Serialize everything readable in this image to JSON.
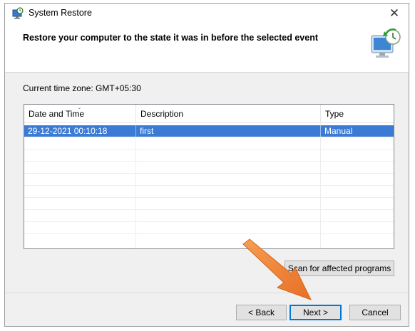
{
  "window": {
    "title": "System Restore",
    "close_glyph": "✕"
  },
  "header": {
    "heading": "Restore your computer to the state it was in before the selected event",
    "icon": "system-restore-monitor-icon"
  },
  "timezone_label": "Current time zone: GMT+05:30",
  "table": {
    "columns": [
      "Date and Time",
      "Description",
      "Type"
    ],
    "sort_indicator": "⌄",
    "rows": [
      {
        "date_time": "29-12-2021 00:10:18",
        "description": "first",
        "type": "Manual",
        "selected": true
      }
    ]
  },
  "buttons": {
    "scan": "Scan for affected programs",
    "back": "< Back",
    "next": "Next >",
    "cancel": "Cancel"
  },
  "colors": {
    "selection": "#3b7bd4",
    "default_button_border": "#0078d7",
    "annotation_arrow": "#f07a22"
  }
}
